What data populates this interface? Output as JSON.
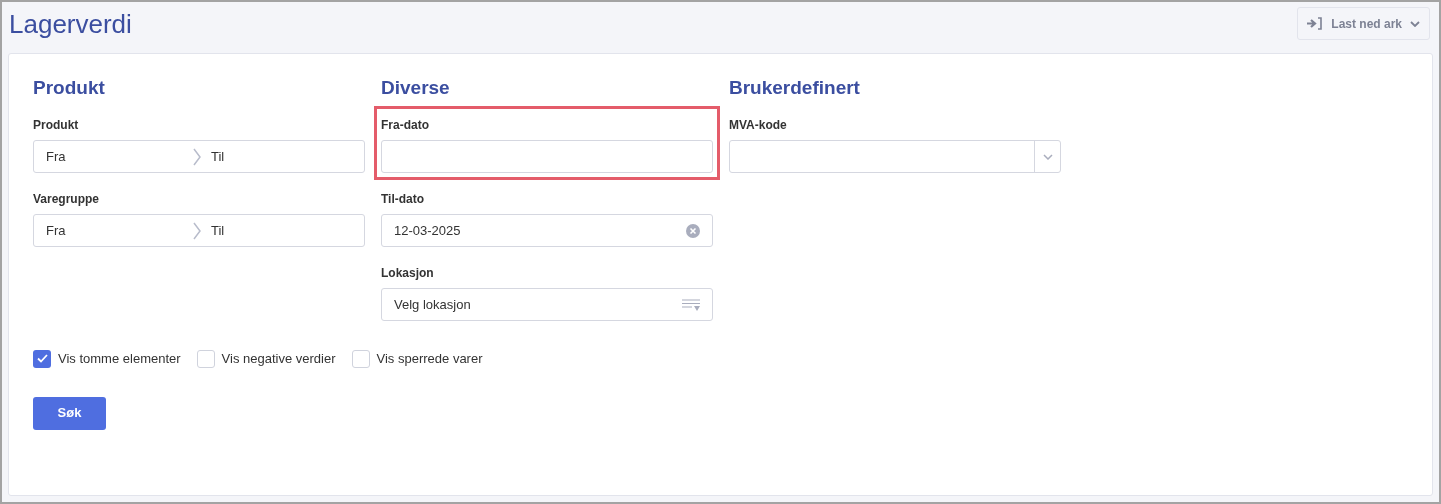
{
  "title": "Lagerverdi",
  "download_button": {
    "label": "Last ned ark"
  },
  "sections": [
    {
      "heading": "Produkt",
      "fields": [
        {
          "kind": "range",
          "label": "Produkt",
          "from": "Fra",
          "to": "Til",
          "highlighted": false
        },
        {
          "kind": "range",
          "label": "Varegruppe",
          "from": "Fra",
          "to": "Til",
          "highlighted": false
        }
      ]
    },
    {
      "heading": "Diverse",
      "fields": [
        {
          "kind": "text",
          "label": "Fra-dato",
          "highlighted": true
        },
        {
          "kind": "date",
          "label": "Til-dato",
          "value": "12-03-2025",
          "highlighted": false
        },
        {
          "kind": "list",
          "label": "Lokasjon",
          "placeholder": "Velg lokasjon",
          "highlighted": false
        }
      ]
    },
    {
      "heading": "Brukerdefinert",
      "fields": [
        {
          "kind": "select",
          "label": "MVA-kode",
          "highlighted": false
        }
      ]
    }
  ],
  "checkboxes": [
    {
      "label": "Vis tomme elementer",
      "checked": true
    },
    {
      "label": "Vis negative verdier",
      "checked": false
    },
    {
      "label": "Vis sperrede varer",
      "checked": false
    }
  ],
  "search_button": {
    "label": "Søk"
  }
}
